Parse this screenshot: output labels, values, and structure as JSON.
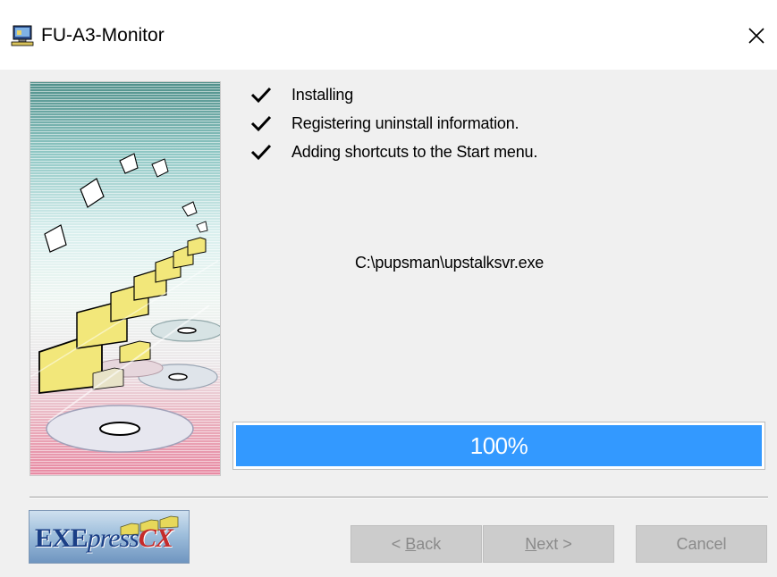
{
  "window": {
    "title": "FU-A3-Monitor",
    "close_symbol": "✕",
    "title_icon": "installer-computer-icon"
  },
  "steps": [
    {
      "label": "Installing",
      "done": true
    },
    {
      "label": "Registering uninstall information.",
      "done": true
    },
    {
      "label": "Adding shortcuts to the Start menu.",
      "done": true
    }
  ],
  "current_file": "C:\\pupsman\\upstalksvr.exe",
  "progress": {
    "value": 1.0,
    "label": "100%",
    "fill_color": "#3399ff"
  },
  "logo": {
    "exe": "EXE",
    "press": "press",
    "cx": "CX"
  },
  "buttons": {
    "back": {
      "label": "< Back",
      "mnemonic": "B",
      "enabled": false
    },
    "next": {
      "label": "Next >",
      "mnemonic": "N",
      "enabled": false
    },
    "cancel": {
      "label": "Cancel",
      "enabled": false
    }
  }
}
